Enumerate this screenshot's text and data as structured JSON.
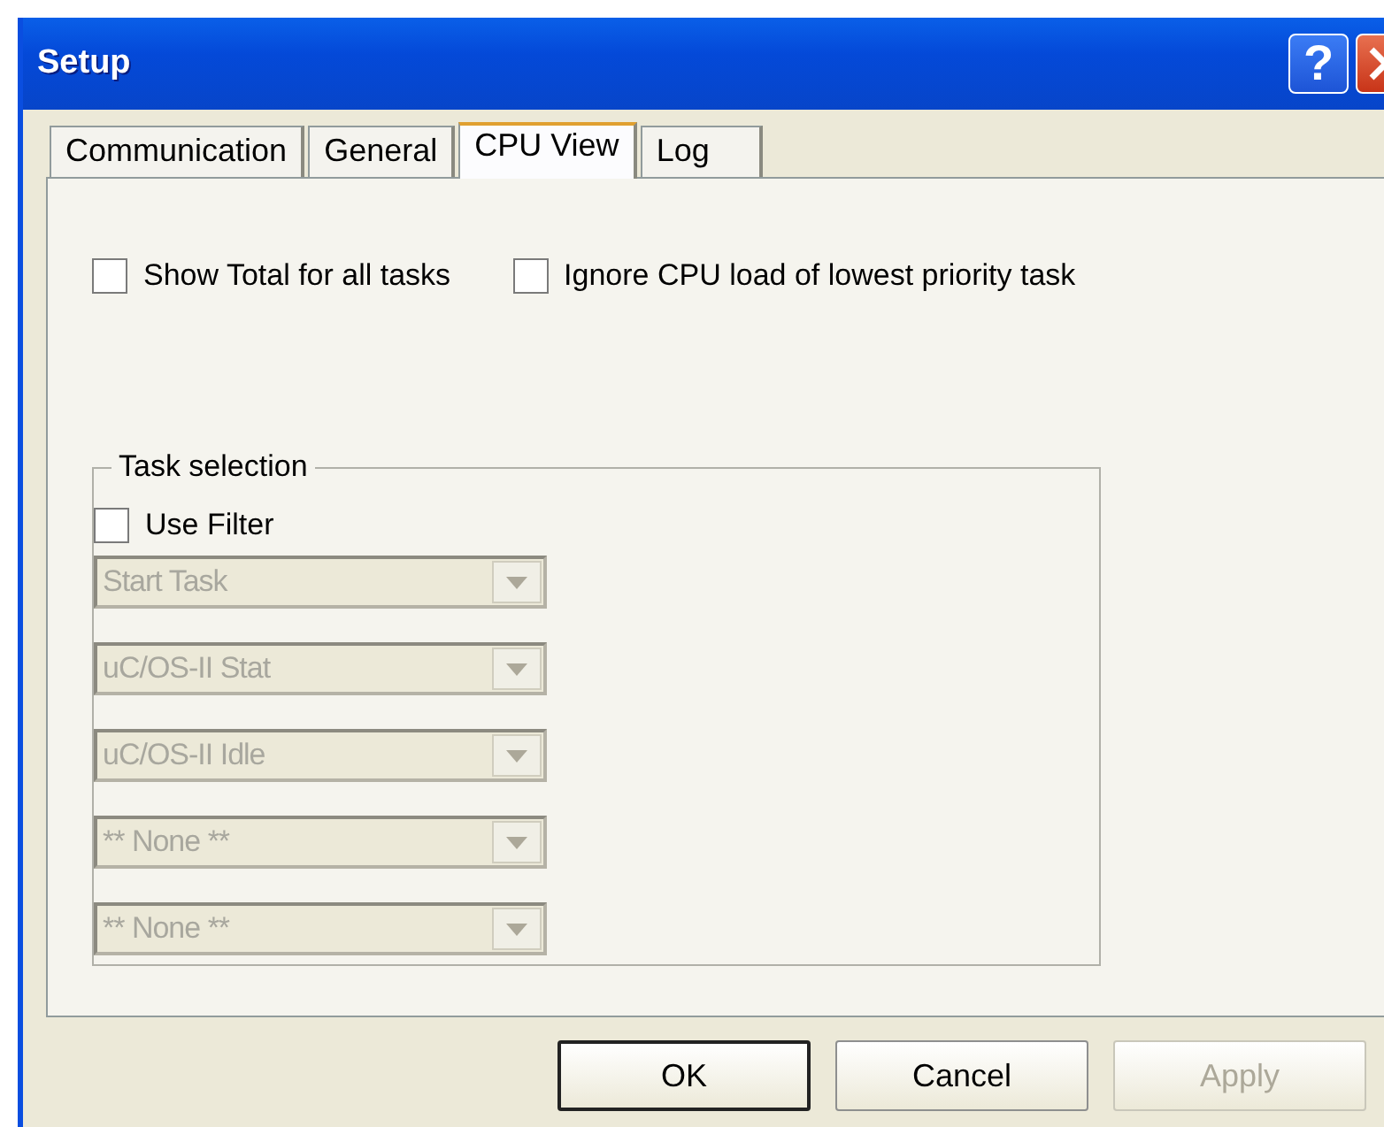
{
  "window": {
    "title": "Setup"
  },
  "title_buttons": [
    {
      "kind": "help",
      "glyph": "?"
    },
    {
      "kind": "close"
    }
  ],
  "tabs": [
    {
      "label": "Communication",
      "selected": false
    },
    {
      "label": "General",
      "selected": false
    },
    {
      "label": "CPU View",
      "selected": true
    },
    {
      "label": "Log",
      "selected": false
    }
  ],
  "options": [
    {
      "label": "Show Total for all tasks",
      "checked": false
    },
    {
      "label": "Ignore CPU load of lowest priority task",
      "checked": false
    }
  ],
  "task_selection": {
    "title": "Task selection",
    "use_filter": {
      "label": "Use Filter",
      "checked": false
    },
    "dropdowns": [
      {
        "value": "Start Task",
        "disabled": true
      },
      {
        "value": "uC/OS-II Stat",
        "disabled": true
      },
      {
        "value": "uC/OS-II Idle",
        "disabled": true
      },
      {
        "value": "** None **",
        "disabled": true
      },
      {
        "value": "** None **",
        "disabled": true
      }
    ]
  },
  "buttons": [
    {
      "label": "OK",
      "default": true,
      "disabled": false
    },
    {
      "label": "Cancel",
      "default": false,
      "disabled": false
    },
    {
      "label": "Apply",
      "default": false,
      "disabled": true
    }
  ]
}
